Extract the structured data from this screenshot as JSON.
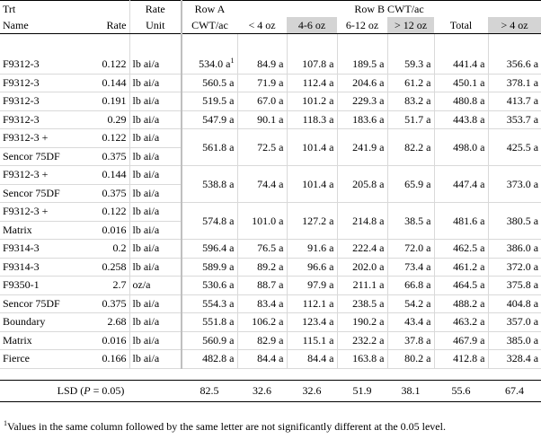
{
  "headers": {
    "trt_line1": "Trt",
    "trt_line2": "Name",
    "rate": "Rate",
    "rate_unit_line1": "Rate",
    "rate_unit_line2": "Unit",
    "row_a_line1": "Row A",
    "row_a_line2": "CWT/ac",
    "row_b": "Row B CWT/ac",
    "lt4": "< 4 oz",
    "b4_6": "4-6 oz",
    "b6_12": "6-12 oz",
    "gt12": "> 12 oz",
    "total": "Total",
    "gt4": "> 4 oz"
  },
  "rows": [
    {
      "name": "F9312-3",
      "rate": "0.122",
      "unit": "lb ai/a",
      "a": "534.0 a",
      "a_sup": "1",
      "lt4": "84.9 a",
      "b46": "107.8 a",
      "b612": "189.5 a",
      "gt12": "59.3 a",
      "total": "441.4 a",
      "gt4": "356.6 a"
    },
    {
      "name": "F9312-3",
      "rate": "0.144",
      "unit": "lb ai/a",
      "a": "560.5 a",
      "lt4": "71.9 a",
      "b46": "112.4 a",
      "b612": "204.6 a",
      "gt12": "61.2 a",
      "total": "450.1 a",
      "gt4": "378.1 a"
    },
    {
      "name": "F9312-3",
      "rate": "0.191",
      "unit": "lb ai/a",
      "a": "519.5 a",
      "lt4": "67.0 a",
      "b46": "101.2 a",
      "b612": "229.3 a",
      "gt12": "83.2 a",
      "total": "480.8 a",
      "gt4": "413.7 a"
    },
    {
      "name": "F9312-3",
      "rate": "0.29",
      "unit": "lb ai/a",
      "a": "547.9 a",
      "lt4": "90.1 a",
      "b46": "118.3 a",
      "b612": "183.6 a",
      "gt12": "51.7 a",
      "total": "443.8 a",
      "gt4": "353.7 a"
    },
    {
      "name": "F9312-3 +",
      "name2": "Sencor 75DF",
      "rate": "0.122",
      "rate2": "0.375",
      "unit": "lb ai/a",
      "unit2": "lb ai/a",
      "a": "561.8 a",
      "lt4": "72.5 a",
      "b46": "101.4 a",
      "b612": "241.9 a",
      "gt12": "82.2 a",
      "total": "498.0 a",
      "gt4": "425.5 a"
    },
    {
      "name": "F9312-3 +",
      "name2": "Sencor 75DF",
      "rate": "0.144",
      "rate2": "0.375",
      "unit": "lb ai/a",
      "unit2": "lb ai/a",
      "a": "538.8 a",
      "lt4": "74.4 a",
      "b46": "101.4 a",
      "b612": "205.8 a",
      "gt12": "65.9 a",
      "total": "447.4 a",
      "gt4": "373.0 a"
    },
    {
      "name": "F9312-3 +",
      "name2": "Matrix",
      "rate": "0.122",
      "rate2": "0.016",
      "unit": "lb ai/a",
      "unit2": "lb ai/a",
      "a": "574.8 a",
      "lt4": "101.0 a",
      "b46": "127.2 a",
      "b612": "214.8 a",
      "gt12": "38.5 a",
      "total": "481.6 a",
      "gt4": "380.5 a"
    },
    {
      "name": "F9314-3",
      "rate": "0.2",
      "unit": "lb ai/a",
      "a": "596.4 a",
      "lt4": "76.5 a",
      "b46": "91.6 a",
      "b612": "222.4 a",
      "gt12": "72.0 a",
      "total": "462.5 a",
      "gt4": "386.0 a"
    },
    {
      "name": "F9314-3",
      "rate": "0.258",
      "unit": "lb ai/a",
      "a": "589.9 a",
      "lt4": "89.2 a",
      "b46": "96.6 a",
      "b612": "202.0 a",
      "gt12": "73.4 a",
      "total": "461.2 a",
      "gt4": "372.0 a"
    },
    {
      "name": "F9350-1",
      "rate": "2.7",
      "unit": "oz/a",
      "a": "530.6 a",
      "lt4": "88.7 a",
      "b46": "97.9 a",
      "b612": "211.1 a",
      "gt12": "66.8 a",
      "total": "464.5 a",
      "gt4": "375.8 a"
    },
    {
      "name": "Sencor 75DF",
      "rate": "0.375",
      "unit": "lb ai/a",
      "a": "554.3 a",
      "lt4": "83.4 a",
      "b46": "112.1 a",
      "b612": "238.5 a",
      "gt12": "54.2 a",
      "total": "488.2 a",
      "gt4": "404.8 a"
    },
    {
      "name": "Boundary",
      "rate": "2.68",
      "unit": "lb ai/a",
      "a": "551.8 a",
      "lt4": "106.2 a",
      "b46": "123.4 a",
      "b612": "190.2 a",
      "gt12": "43.4 a",
      "total": "463.2 a",
      "gt4": "357.0 a"
    },
    {
      "name": "Matrix",
      "rate": "0.016",
      "unit": "lb ai/a",
      "a": "560.9 a",
      "lt4": "82.9 a",
      "b46": "115.1 a",
      "b612": "232.2 a",
      "gt12": "37.8 a",
      "total": "467.9 a",
      "gt4": "385.0 a"
    },
    {
      "name": "Fierce",
      "rate": "0.166",
      "unit": "lb ai/a",
      "a": "482.8 a",
      "lt4": "84.4 a",
      "b46": "84.4 a",
      "b612": "163.8 a",
      "gt12": "80.2 a",
      "total": "412.8 a",
      "gt4": "328.4 a"
    }
  ],
  "lsd": {
    "label_prefix": "LSD (",
    "label_p": "P",
    "label_suffix": " = 0.05)",
    "a": "82.5",
    "lt4": "32.6",
    "b46": "32.6",
    "b612": "51.9",
    "gt12": "38.1",
    "total": "55.6",
    "gt4": "67.4"
  },
  "footnote": {
    "marker": "1",
    "text": "Values in the same column followed by the same letter are not significantly different at the 0.05 level."
  }
}
